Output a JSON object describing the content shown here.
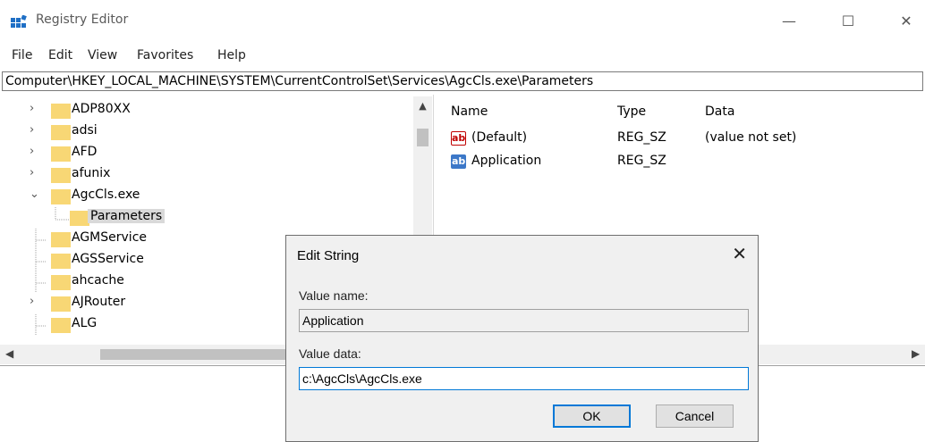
{
  "window": {
    "title": "Registry Editor"
  },
  "window_controls": {
    "minimize": "—",
    "maximize": "☐",
    "close": "✕"
  },
  "menu": [
    "File",
    "Edit",
    "View",
    "Favorites",
    "Help"
  ],
  "address_bar": "Computer\\HKEY_LOCAL_MACHINE\\SYSTEM\\CurrentControlSet\\Services\\AgcCls.exe\\Parameters",
  "tree": [
    {
      "label": "ADP80XX",
      "expander": "›"
    },
    {
      "label": "adsi",
      "expander": "›"
    },
    {
      "label": "AFD",
      "expander": "›"
    },
    {
      "label": "afunix",
      "expander": "›"
    },
    {
      "label": "AgcCls.exe",
      "expander": "⌄"
    },
    {
      "label": "Parameters",
      "expander": ""
    },
    {
      "label": "AGMService",
      "expander": ""
    },
    {
      "label": "AGSService",
      "expander": ""
    },
    {
      "label": "ahcache",
      "expander": ""
    },
    {
      "label": "AJRouter",
      "expander": "›"
    },
    {
      "label": "ALG",
      "expander": ""
    }
  ],
  "values": {
    "headers": {
      "name": "Name",
      "type": "Type",
      "data": "Data"
    },
    "rows": [
      {
        "name": "(Default)",
        "type": "REG_SZ",
        "data": "(value not set)",
        "icon": "string-value-icon"
      },
      {
        "name": "Application",
        "type": "REG_SZ",
        "data": "",
        "icon": "string-value-icon"
      }
    ]
  },
  "dialog": {
    "title": "Edit String",
    "value_name_label": "Value name:",
    "value_name": "Application",
    "value_data_label": "Value data:",
    "value_data": "c:\\AgcCls\\AgcCls.exe",
    "ok_label": "OK",
    "cancel_label": "Cancel"
  },
  "colors": {
    "folder": "#f8d775",
    "accent": "#0078d7"
  }
}
